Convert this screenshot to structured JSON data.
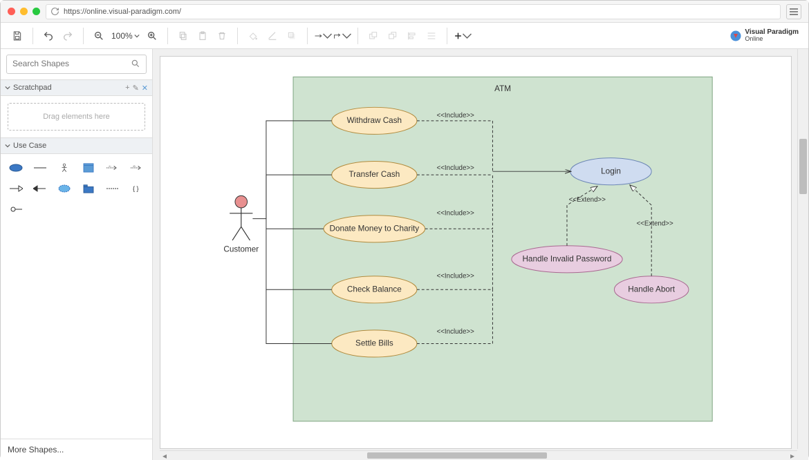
{
  "browser": {
    "url": "https://online.visual-paradigm.com/"
  },
  "toolbar": {
    "zoom": "100%"
  },
  "logo": {
    "line1": "Visual Paradigm",
    "line2": "Online"
  },
  "sidebar": {
    "search_placeholder": "Search Shapes",
    "scratchpad": {
      "title": "Scratchpad",
      "drop_hint": "Drag elements here"
    },
    "usecase": {
      "title": "Use Case"
    },
    "more_shapes": "More Shapes..."
  },
  "diagram": {
    "system_name": "ATM",
    "actor": "Customer",
    "usecases": {
      "withdraw": "Withdraw Cash",
      "transfer": "Transfer Cash",
      "donate": "Donate Money to Charity",
      "check": "Check Balance",
      "settle": "Settle Bills",
      "login": "Login",
      "invalid": "Handle Invalid Password",
      "abort": "Handle Abort"
    },
    "stereotypes": {
      "include": "<<Include>>",
      "extend": "<<Extend>>"
    }
  }
}
